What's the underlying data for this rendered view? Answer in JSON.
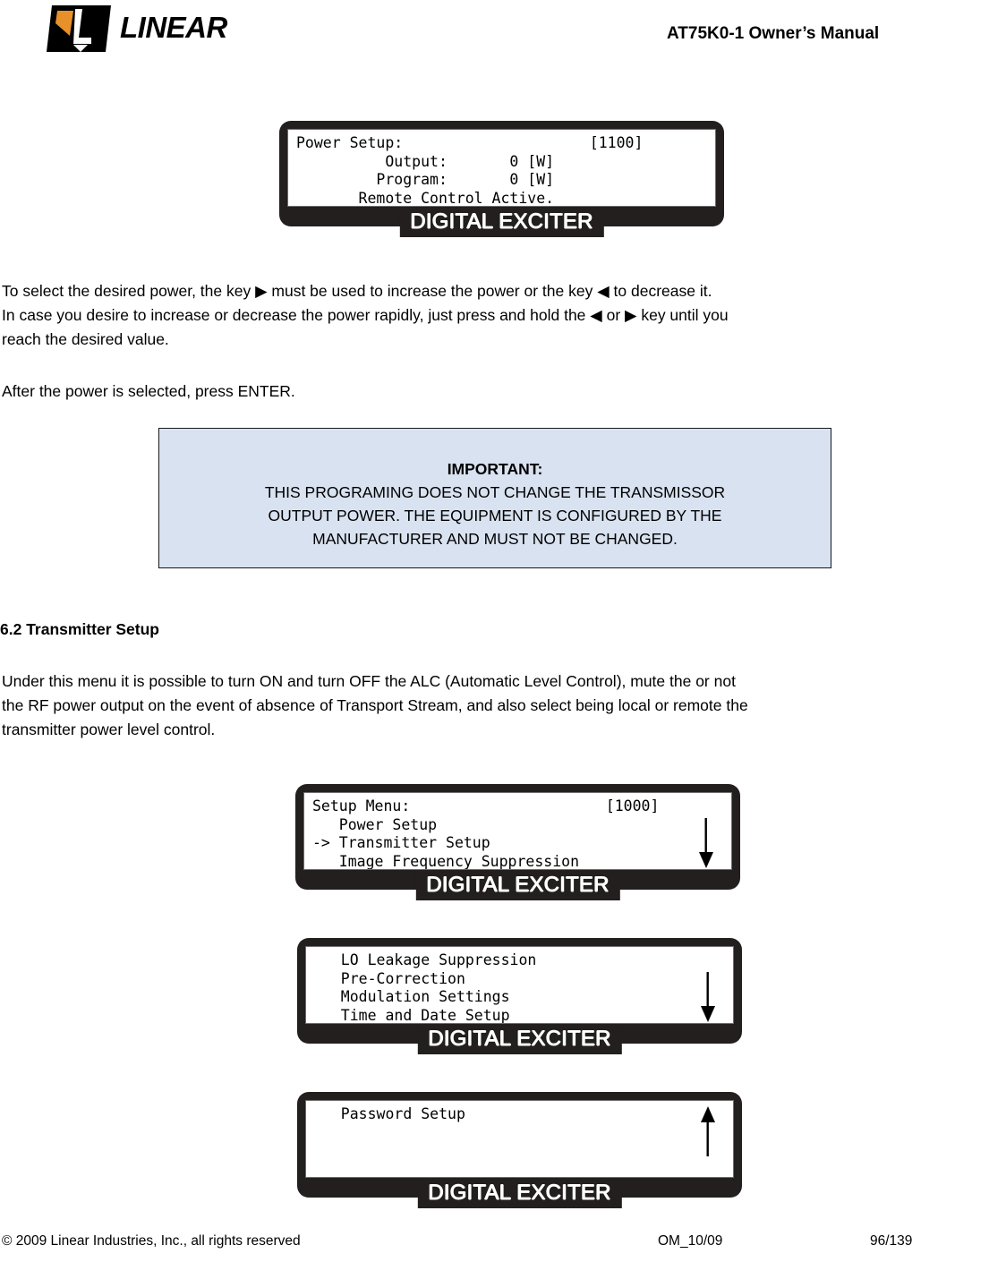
{
  "header": {
    "logo_wordmark": "LINEAR",
    "title": "AT75K0-1 Owner’s Manual"
  },
  "lcd_panels": [
    {
      "name": "power-setup",
      "badge": "DIGITAL EXCITER",
      "screen_lines": [
        "Power Setup:                     [1100]",
        "          Output:       0 [W]",
        "         Program:       0 [W]",
        "       Remote Control Active."
      ],
      "arrow": "none"
    },
    {
      "name": "setup-menu",
      "badge": "DIGITAL EXCITER",
      "screen_lines": [
        "Setup Menu:                      [1000]",
        "   Power Setup",
        "-> Transmitter Setup",
        "   Image Frequency Suppression"
      ],
      "arrow": "down"
    },
    {
      "name": "setup-menu-page2",
      "badge": "DIGITAL EXCITER",
      "screen_lines": [
        "   LO Leakage Suppression",
        "   Pre-Correction",
        "   Modulation Settings",
        "   Time and Date Setup"
      ],
      "arrow": "down"
    },
    {
      "name": "setup-menu-page3",
      "badge": "DIGITAL EXCITER",
      "screen_lines": [
        "   Password Setup",
        "",
        "",
        ""
      ],
      "arrow": "up"
    }
  ],
  "paragraphs": {
    "select_power_line1": "To select the desired power, the key  ▶  must be used to increase the power or the key  ◀  to decrease it.",
    "select_power_line2": "In case you desire to increase or decrease the power rapidly, just press and hold the ◀  or  ▶  key  until you",
    "select_power_line3": "reach the desired value.",
    "after_power": "After the power is selected, press ENTER.",
    "transmitter_line1": "Under this menu it is possible to turn ON and turn OFF the ALC (Automatic Level Control), mute the or not",
    "transmitter_line2": "the RF power output  on the event of absence of Transport Stream, and also select being local or remote the",
    "transmitter_line3": "transmitter power level control."
  },
  "important_box": {
    "heading": "IMPORTANT:",
    "line1": "THIS PROGRAMING DOES NOT CHANGE THE TRANSMISSOR",
    "line2": "OUTPUT POWER. THE EQUIPMENT IS CONFIGURED BY THE",
    "line3": "MANUFACTURER AND MUST NOT BE CHANGED."
  },
  "section": {
    "heading": "6.2 Transmitter Setup"
  },
  "footer": {
    "copyright": "© 2009 Linear Industries, Inc., all rights reserved",
    "doc_ref": "OM_10/09",
    "page_number": "96/139"
  },
  "colors": {
    "callout_background": "#d9e2f0",
    "lcd_frame": "#231f1f",
    "logo_accent": "#e8912a"
  }
}
